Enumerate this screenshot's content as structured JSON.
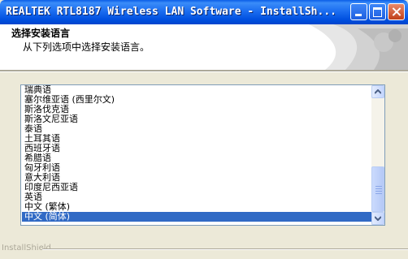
{
  "window": {
    "title": "REALTEK RTL8187 Wireless LAN Software - InstallSh..."
  },
  "header": {
    "title": "选择安装语言",
    "subtitle": "从下列选项中选择安装语言。"
  },
  "languages": [
    "瑞典语",
    "塞尔维亚语 (西里尔文)",
    "斯洛伐克语",
    "斯洛文尼亚语",
    "泰语",
    "土耳其语",
    "西班牙语",
    "希腊语",
    "匈牙利语",
    "意大利语",
    "印度尼西亚语",
    "英语",
    "中文 (繁体)",
    "中文 (简体)"
  ],
  "selected_language": "中文 (简体)",
  "footer": {
    "brand": "InstallShield"
  },
  "colors": {
    "titlebar": "#0054e3",
    "selection": "#316ac5",
    "dialog_bg": "#ece9d8"
  }
}
